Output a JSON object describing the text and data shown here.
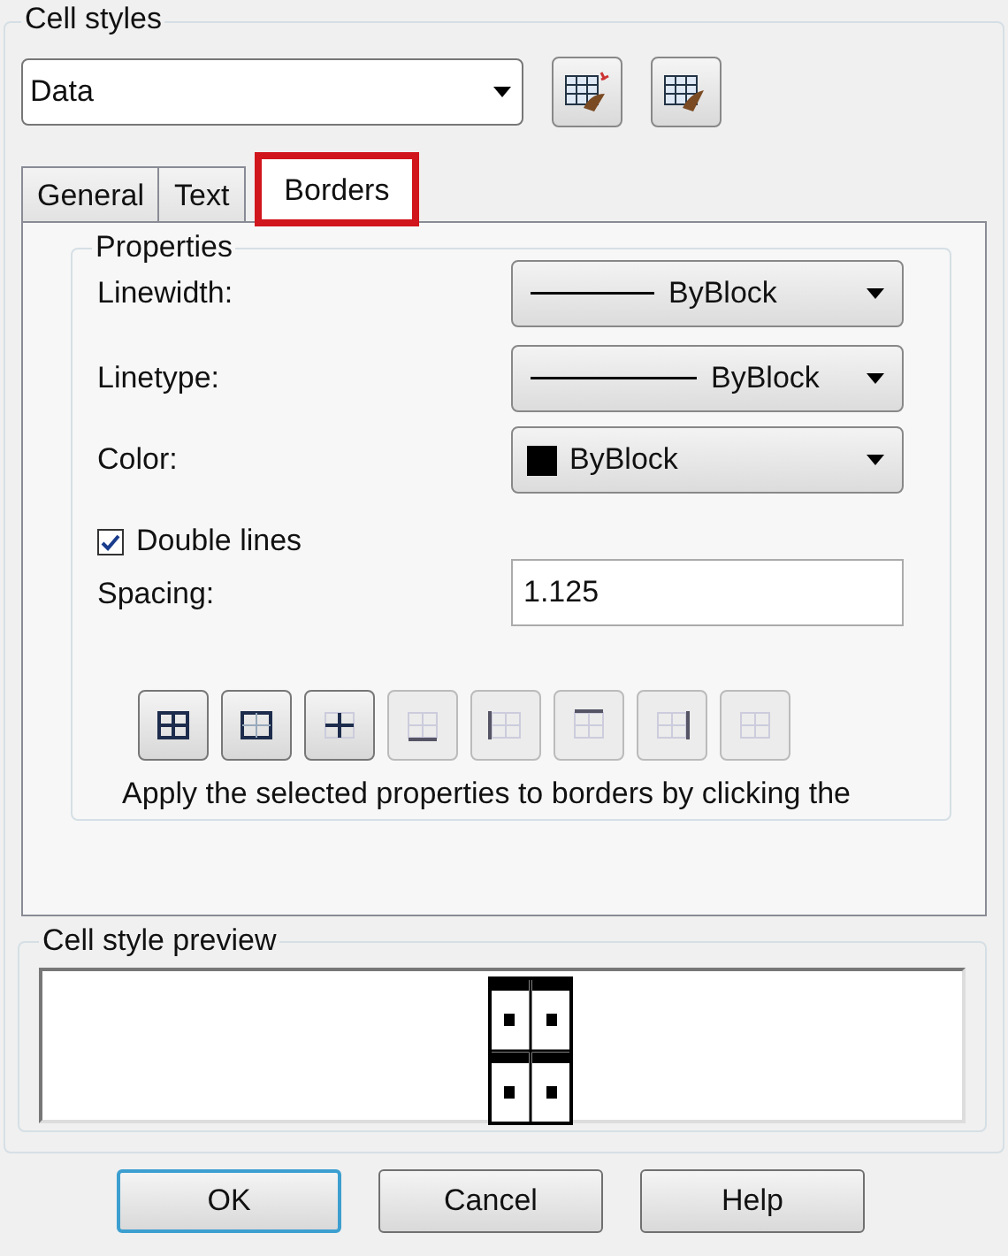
{
  "group_title": "Cell styles",
  "style_select": {
    "value": "Data"
  },
  "style_buttons": [
    {
      "kind": "new"
    },
    {
      "kind": "manage"
    }
  ],
  "tabs": [
    {
      "label": "General",
      "selected": false
    },
    {
      "label": "Text",
      "selected": false
    },
    {
      "label": "Borders",
      "selected": true,
      "highlighted": true
    }
  ],
  "properties": {
    "title": "Properties",
    "rows": [
      {
        "kind": "line_select",
        "label": "Linewidth:",
        "value": "ByBlock"
      },
      {
        "kind": "line_select",
        "label": "Linetype:",
        "value": "ByBlock"
      },
      {
        "kind": "color_select",
        "label": "Color:",
        "value": "ByBlock",
        "color": "#000000"
      },
      {
        "kind": "checkbox",
        "label": "Double lines",
        "checked": true
      },
      {
        "kind": "text",
        "label": "Spacing:",
        "value": "1.125"
      }
    ],
    "border_buttons": [
      {
        "kind": "all",
        "disabled": false
      },
      {
        "kind": "outside",
        "disabled": false
      },
      {
        "kind": "inside",
        "disabled": false
      },
      {
        "kind": "bottom",
        "disabled": true
      },
      {
        "kind": "left",
        "disabled": true
      },
      {
        "kind": "top",
        "disabled": true
      },
      {
        "kind": "right",
        "disabled": true
      },
      {
        "kind": "none",
        "disabled": true
      }
    ],
    "hint": "Apply the selected properties to borders by clicking the"
  },
  "preview": {
    "title": "Cell style preview"
  },
  "buttons": [
    {
      "label": "OK",
      "default": true
    },
    {
      "label": "Cancel",
      "default": false
    },
    {
      "label": "Help",
      "default": false
    }
  ]
}
